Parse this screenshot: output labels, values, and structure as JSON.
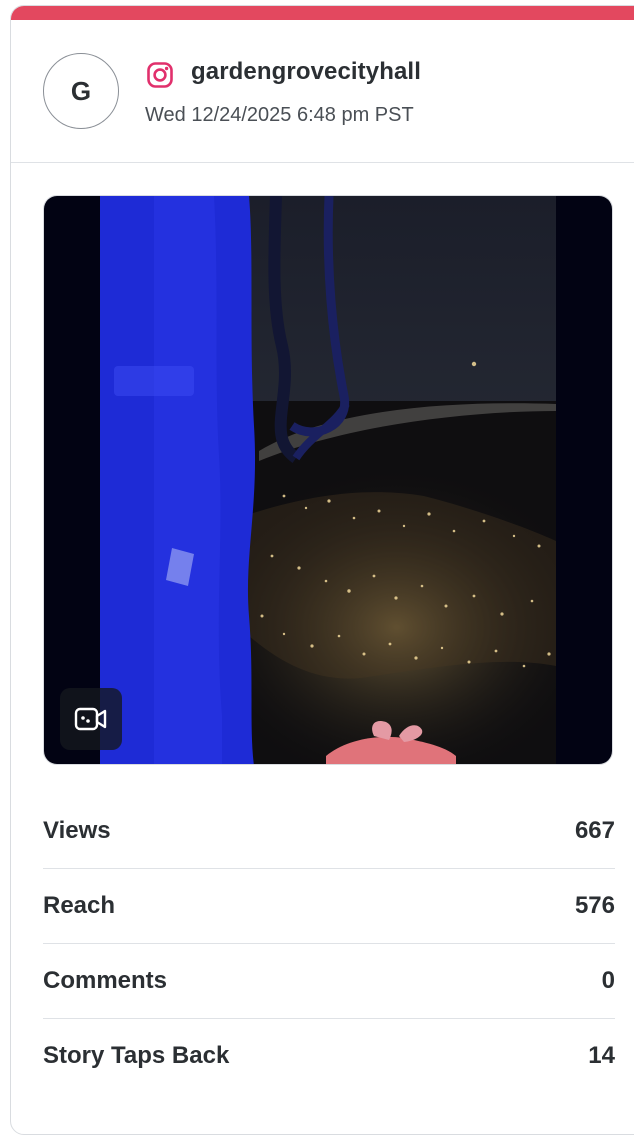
{
  "colors": {
    "accent": "#e3485f",
    "instagram": "#e1306c"
  },
  "post": {
    "avatar_letter": "G",
    "platform_icon": "instagram-icon",
    "account": "gardengrovecityhall",
    "timestamp": "Wed 12/24/2025 6:48 pm PST",
    "media_type_icon": "video-icon"
  },
  "metrics": [
    {
      "label": "Views",
      "value": "667"
    },
    {
      "label": "Reach",
      "value": "576"
    },
    {
      "label": "Comments",
      "value": "0"
    },
    {
      "label": "Story Taps Back",
      "value": "14"
    }
  ]
}
